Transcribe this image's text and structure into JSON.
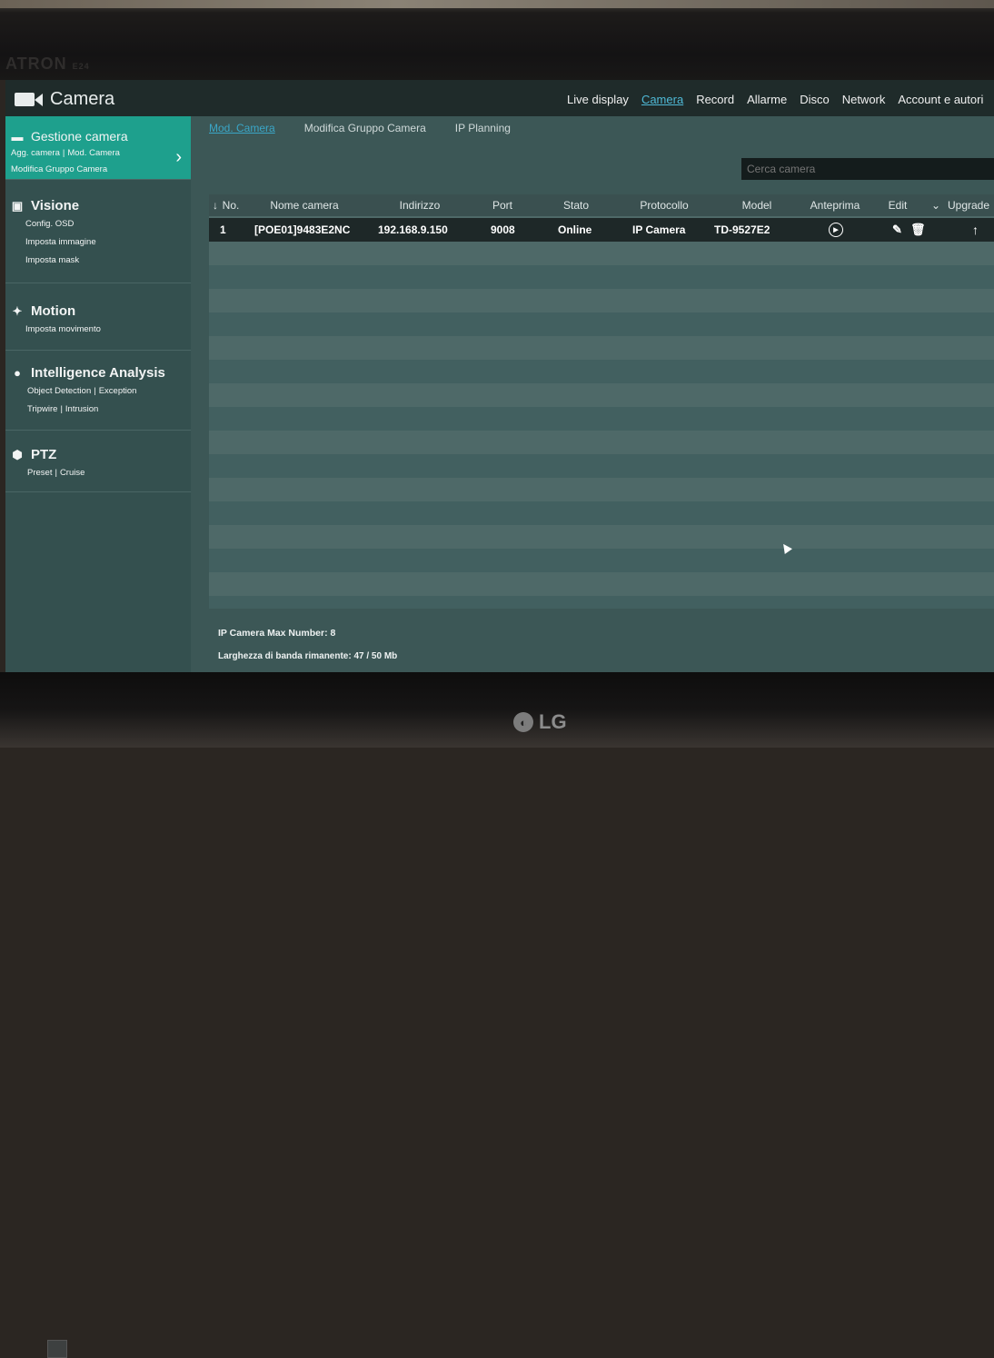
{
  "monitor": {
    "top_brand": "ATRON",
    "top_brand_model": "E24",
    "bottom_brand": "LG"
  },
  "app": {
    "title": "Camera",
    "title_icon": "camera-icon"
  },
  "topnav": {
    "items": [
      "Live display",
      "Camera",
      "Record",
      "Allarme",
      "Disco",
      "Network",
      "Account e autori"
    ],
    "active": "Camera"
  },
  "sidebar": {
    "sections": [
      {
        "title": "Gestione camera",
        "icon": "camera-icon",
        "active": true,
        "links": [
          "Agg. camera",
          "Mod. Camera",
          "Modifica Gruppo Camera"
        ]
      },
      {
        "title": "Visione",
        "icon": "display-icon",
        "links": [
          "Config. OSD",
          "Imposta immagine",
          "Imposta mask"
        ]
      },
      {
        "title": "Motion",
        "icon": "running-person-icon",
        "links": [
          "Imposta movimento"
        ]
      },
      {
        "title": "Intelligence Analysis",
        "icon": "analysis-icon",
        "links": [
          "Object Detection",
          "Exception",
          "Tripwire",
          "Intrusion"
        ]
      },
      {
        "title": "PTZ",
        "icon": "ptz-icon",
        "links": [
          "Preset",
          "Cruise"
        ]
      }
    ]
  },
  "subtabs": {
    "items": [
      "Mod. Camera",
      "Modifica Gruppo Camera",
      "IP Planning"
    ],
    "active": "Mod. Camera"
  },
  "search": {
    "placeholder": "Cerca camera"
  },
  "table": {
    "headers": [
      "No.",
      "Nome camera",
      "Indirizzo",
      "Port",
      "Stato",
      "Protocollo",
      "Model",
      "Anteprima",
      "Edit",
      "Upgrade"
    ],
    "rows": [
      {
        "no": "1",
        "name": "[POE01]9483E2NC",
        "address": "192.168.9.150",
        "port": "9008",
        "status": "Online",
        "protocol": "IP Camera",
        "model": "TD-9527E2"
      }
    ]
  },
  "footer": {
    "max_number": "IP Camera Max Number: 8",
    "bandwidth": "Larghezza di banda rimanente: 47 / 50 Mb"
  }
}
